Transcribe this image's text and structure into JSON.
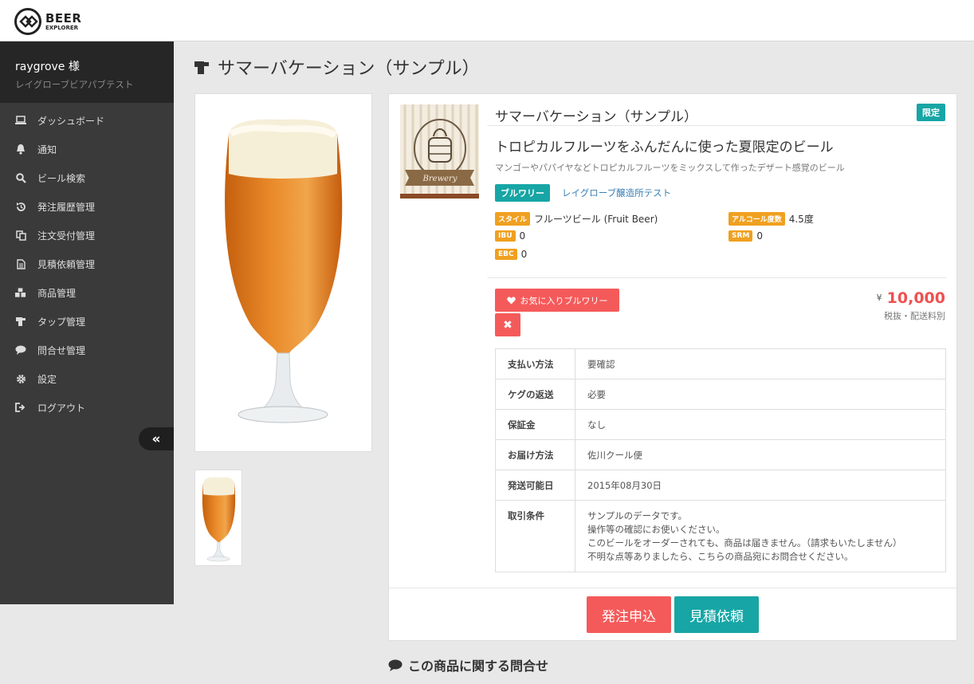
{
  "app": {
    "logo_line1": "BEER",
    "logo_line2": "EXPLORER"
  },
  "sidebar": {
    "user_name": "raygrove 様",
    "user_org": "レイグローブビアパブテスト",
    "items": [
      {
        "label": "ダッシュボード",
        "icon": "laptop-icon"
      },
      {
        "label": "通知",
        "icon": "bell-icon"
      },
      {
        "label": "ビール検索",
        "icon": "search-icon"
      },
      {
        "label": "発注履歴管理",
        "icon": "history-icon"
      },
      {
        "label": "注文受付管理",
        "icon": "copy-icon"
      },
      {
        "label": "見積依頼管理",
        "icon": "document-icon"
      },
      {
        "label": "商品管理",
        "icon": "cubes-icon"
      },
      {
        "label": "タップ管理",
        "icon": "tap-icon"
      },
      {
        "label": "問合せ管理",
        "icon": "comment-icon"
      },
      {
        "label": "設定",
        "icon": "gear-icon"
      },
      {
        "label": "ログアウト",
        "icon": "sign-out-icon"
      }
    ],
    "collapse_label": "«"
  },
  "page": {
    "title": "サマーバケーション（サンプル）"
  },
  "product": {
    "name": "サマーバケーション（サンプル）",
    "limited_badge": "限定",
    "catch_copy": "トロピカルフルーツをふんだんに使った夏限定のビール",
    "description": "マンゴーやパパイヤなどトロピカルフルーツをミックスして作ったデザート感覚のビール",
    "brewery_tag": "ブルワリー",
    "brewery_name": "レイグローブ醸造所テスト",
    "specs": {
      "style_label": "スタイル",
      "style_value": "フルーツビール (Fruit Beer)",
      "abv_label": "アルコール度数",
      "abv_value": "4.5度",
      "ibu_label": "IBU",
      "ibu_value": "0",
      "srm_label": "SRM",
      "srm_value": "0",
      "ebc_label": "EBC",
      "ebc_value": "0"
    },
    "favorite_button": "お気に入りブルワリー",
    "remove_button": "✖",
    "price_symbol": "¥",
    "price": "10,000",
    "price_note": "税抜・配送料別",
    "brewery_image_text": "Brewery"
  },
  "terms_table": [
    {
      "key": "支払い方法",
      "value": "要確認"
    },
    {
      "key": "ケグの返送",
      "value": "必要"
    },
    {
      "key": "保証金",
      "value": "なし"
    },
    {
      "key": "お届け方法",
      "value": "佐川クール便"
    },
    {
      "key": "発送可能日",
      "value": "2015年08月30日"
    },
    {
      "key": "取引条件",
      "value_lines": [
        "サンプルのデータです。",
        "操作等の確認にお使いください。",
        "このビールをオーダーされても、商品は届きません。（請求もいたしません）",
        "不明な点等ありましたら、こちらの商品宛にお問合せください。"
      ]
    }
  ],
  "actions": {
    "order_button": "発注申込",
    "quote_button": "見積依頼"
  },
  "inquiry": {
    "title": "この商品に関する問合せ"
  },
  "colors": {
    "teal": "#17a5a5",
    "coral": "#f55a5a",
    "orange": "#f0a020",
    "sidebar_bg": "#3a3a3a"
  }
}
